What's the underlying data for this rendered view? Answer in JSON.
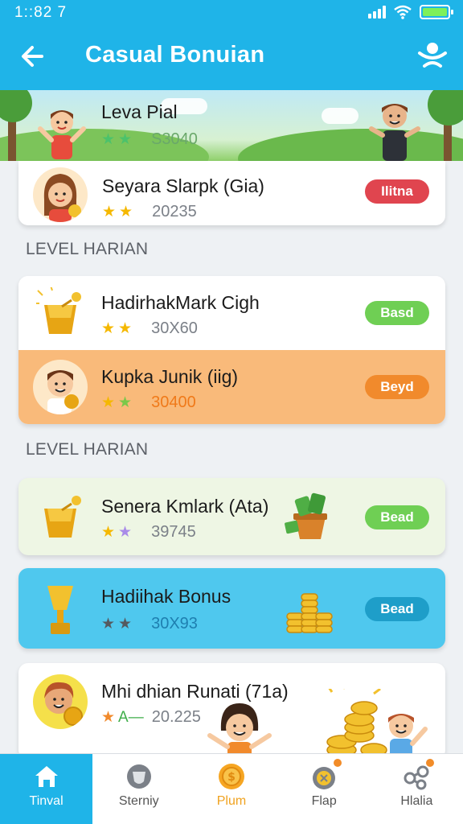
{
  "status_bar": {
    "time": "1::82 7"
  },
  "header": {
    "title": "Casual Bonuian"
  },
  "banner": {
    "title": "Leva Pial",
    "score": "S3040",
    "star_colors": [
      "#4cc26b",
      "#4cc26b"
    ]
  },
  "featured": {
    "title": "Seyara Slarpk (Gia)",
    "score": "20235",
    "star_colors": [
      "#f5b800",
      "#f5b800"
    ],
    "button_label": "Ilitna",
    "button_color": "#e0454f"
  },
  "sections": [
    {
      "header": "LEVEL HARIAN",
      "items": [
        {
          "title": "HadirhakMark Cigh",
          "score": "30X60",
          "star_colors": [
            "#f5b800",
            "#f5b800"
          ],
          "button_label": "Basd",
          "button_color": "#6fcf54"
        },
        {
          "title": "Kupka Junik (iig)",
          "score": "30400",
          "star_colors": [
            "#f5b800",
            "#7bc84a"
          ],
          "button_label": "Beyd",
          "button_color": "#f18a2c"
        }
      ]
    },
    {
      "header": "LEVEL HARIAN",
      "items": [
        {
          "title": "Senera Kmlark (Ata)",
          "score": "39745",
          "star_colors": [
            "#f5b800",
            "#a98be8"
          ],
          "button_label": "Bead",
          "button_color": "#6fcf54"
        },
        {
          "title": "Hadiihak Bonus",
          "score": "30X93",
          "star_colors": [
            "#555a60",
            "#555a60"
          ],
          "button_label": "Bead",
          "button_color": "#1e9ec9"
        },
        {
          "title": "Mhi dhian Runati (71a)",
          "score": "20.225",
          "rank_label": "A—",
          "star_colors": [
            "#f18a2c"
          ]
        }
      ]
    }
  ],
  "bottom_nav": [
    {
      "label": "Tinval",
      "icon": "home-icon",
      "active": true
    },
    {
      "label": "Sterniy",
      "icon": "shield-icon",
      "active": false
    },
    {
      "label": "Plum",
      "icon": "coin-icon",
      "active": false
    },
    {
      "label": "Flap",
      "icon": "medal-icon",
      "active": false
    },
    {
      "label": "Hlalia",
      "icon": "share-icon",
      "active": false
    }
  ],
  "colors": {
    "primary": "#1fb4e8",
    "star_glyph": "★",
    "plum_label": "#f0a21f"
  }
}
